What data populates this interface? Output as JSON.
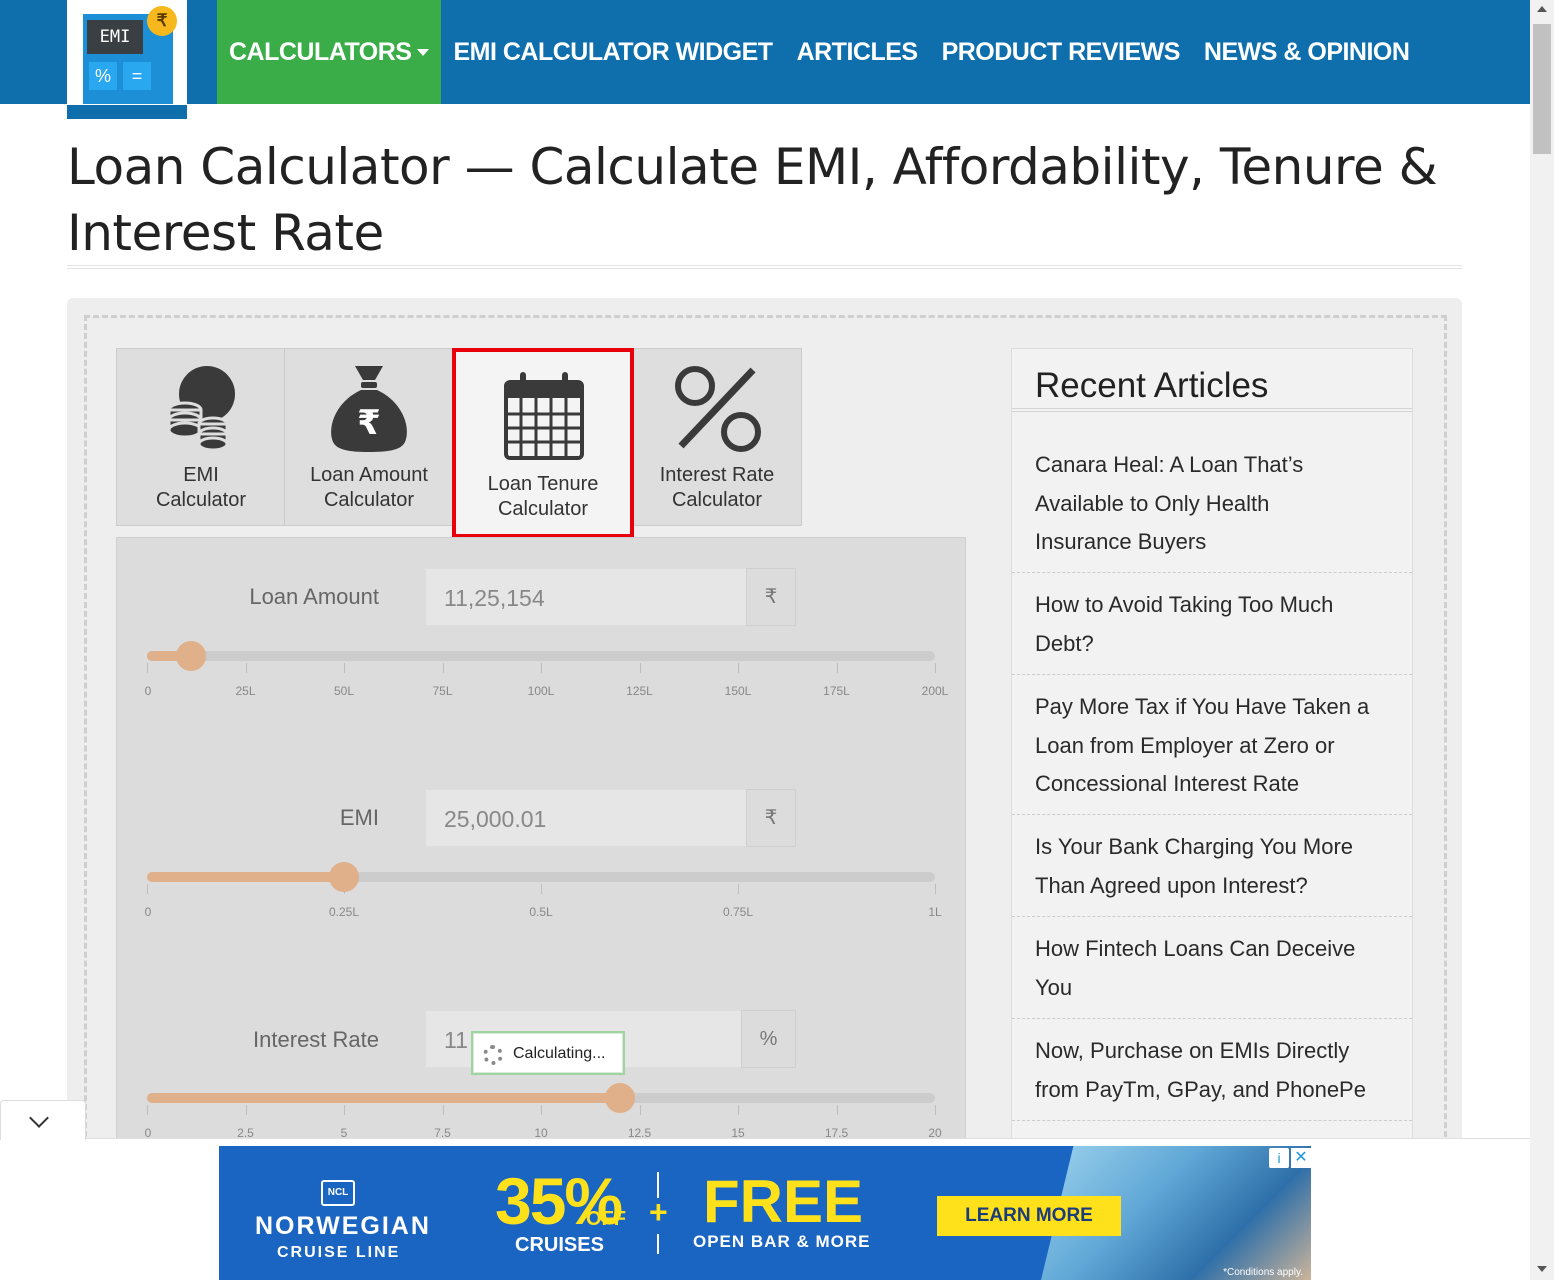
{
  "nav": {
    "logo_screen": "EMI",
    "logo_coin": "₹",
    "logo_pct": "%",
    "logo_eq": "=",
    "items": [
      {
        "label": "CALCULATORS",
        "active": true,
        "has_dropdown": true
      },
      {
        "label": "EMI CALCULATOR WIDGET"
      },
      {
        "label": "ARTICLES"
      },
      {
        "label": "PRODUCT REVIEWS"
      },
      {
        "label": "NEWS & OPINION"
      }
    ]
  },
  "page": {
    "title": "Loan Calculator — Calculate EMI, Affordability, Tenure & Interest Rate"
  },
  "tabs": [
    {
      "label_1": "EMI",
      "label_2": "Calculator",
      "icon": "coins-icon"
    },
    {
      "label_1": "Loan Amount",
      "label_2": "Calculator",
      "icon": "money-bag-icon"
    },
    {
      "label_1": "Loan Tenure",
      "label_2": "Calculator",
      "icon": "calendar-icon",
      "active": true
    },
    {
      "label_1": "Interest Rate",
      "label_2": "Calculator",
      "icon": "percent-icon"
    }
  ],
  "fields": {
    "loan_amount": {
      "label": "Loan Amount",
      "value": "11,25,154",
      "unit": "₹",
      "slider_fraction": 0.056,
      "ticks": [
        "0",
        "25L",
        "50L",
        "75L",
        "100L",
        "125L",
        "150L",
        "175L",
        "200L"
      ]
    },
    "emi": {
      "label": "EMI",
      "value": "25,000.01",
      "unit": "₹",
      "slider_fraction": 0.25,
      "ticks": [
        "0",
        "0.25L",
        "0.5L",
        "0.75L",
        "1L"
      ]
    },
    "interest_rate": {
      "label": "Interest Rate",
      "value": "11",
      "unit": "%",
      "slider_fraction": 0.6,
      "ticks": [
        "0",
        "2.5",
        "5",
        "7.5",
        "10",
        "12.5",
        "15",
        "17.5",
        "20"
      ]
    }
  },
  "calculating_text": "Calculating...",
  "sidebar": {
    "title": "Recent Articles",
    "articles": [
      {
        "line_1": "Canara Heal: A Loan That’s",
        "line_2": "Available to Only Health",
        "line_3": "Insurance Buyers"
      },
      {
        "line_1": "How to Avoid Taking Too Much",
        "line_2": "Debt?"
      },
      {
        "line_1": "Pay More Tax if You Have Taken a",
        "line_2": "Loan from Employer at Zero or",
        "line_3": "Concessional Interest Rate"
      },
      {
        "line_1": "Is Your Bank Charging You More",
        "line_2": "Than Agreed upon Interest?"
      },
      {
        "line_1": "How Fintech Loans Can Deceive",
        "line_2": "You"
      },
      {
        "line_1": "Now, Purchase on EMIs Directly",
        "line_2": "from PayTm, GPay, and PhonePe"
      }
    ]
  },
  "ad": {
    "badge": "NCL",
    "brand": "NORWEGIAN",
    "brand_sub": "CRUISE LINE",
    "percent": "35%",
    "off": "OFF",
    "cruises": "CRUISES",
    "plus": "+",
    "free": "FREE",
    "open_bar": "OPEN BAR & MORE",
    "cta": "LEARN MORE",
    "conditions": "*Conditions apply.",
    "info": "i",
    "close": "✕"
  },
  "colors": {
    "header_bg": "#0f6fad",
    "nav_active_bg": "#3aad49",
    "slider_fill": "#e0b08a",
    "active_tab_border": "#e8000a",
    "ad_bg": "#1a64c2",
    "ad_accent": "#ffe11b"
  }
}
